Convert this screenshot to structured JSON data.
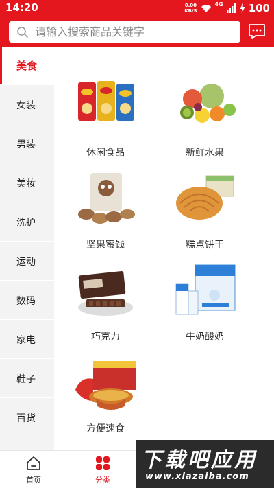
{
  "statusbar": {
    "time": "14:20",
    "speed_value": "0.00",
    "speed_unit": "KB/S",
    "network": "4G",
    "battery": "100"
  },
  "search": {
    "placeholder": "请输入搜索商品关键字"
  },
  "sidebar": {
    "items": [
      {
        "label": "美食",
        "active": true
      },
      {
        "label": "女装"
      },
      {
        "label": "男装"
      },
      {
        "label": "美妆"
      },
      {
        "label": "洗护"
      },
      {
        "label": "运动"
      },
      {
        "label": "数码"
      },
      {
        "label": "家电"
      },
      {
        "label": "鞋子"
      },
      {
        "label": "百货"
      }
    ]
  },
  "grid": {
    "items": [
      {
        "label": "休闲食品",
        "icon": "chips-icon"
      },
      {
        "label": "新鲜水果",
        "icon": "fruit-icon"
      },
      {
        "label": "坚果蜜饯",
        "icon": "nuts-icon"
      },
      {
        "label": "糕点饼干",
        "icon": "bread-icon"
      },
      {
        "label": "巧克力",
        "icon": "chocolate-icon"
      },
      {
        "label": "牛奶酸奶",
        "icon": "milk-icon"
      },
      {
        "label": "方便速食",
        "icon": "noodles-icon"
      }
    ]
  },
  "bottomnav": {
    "items": [
      {
        "label": "首页",
        "icon": "home-icon"
      },
      {
        "label": "分类",
        "icon": "category-icon",
        "active": true
      }
    ]
  },
  "watermark": {
    "main": "下载吧应用",
    "url": "www.xiazaiba.com"
  },
  "colors": {
    "brand": "#e4161e",
    "sidebar_bg": "#f3f3f3"
  }
}
